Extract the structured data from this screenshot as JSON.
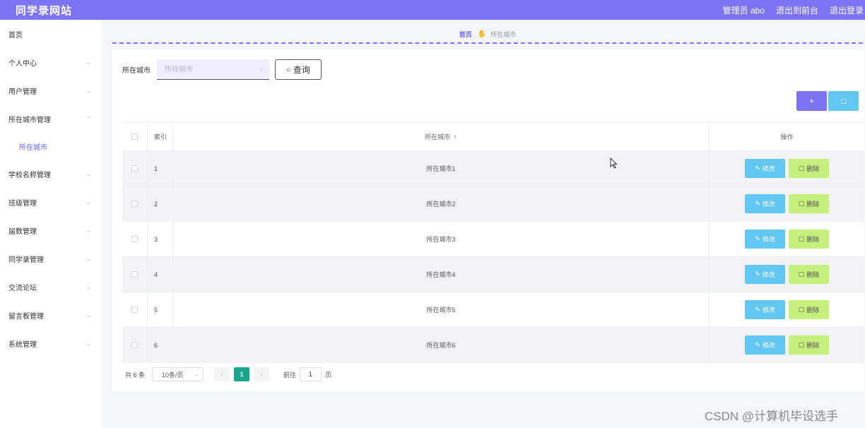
{
  "header": {
    "brand": "同学录网站",
    "admin_label": "管理员 abo",
    "back_front": "退出到前台",
    "logout": "退出登录",
    "accent": "#7c74f4"
  },
  "sidebar": {
    "home": "首页",
    "items": [
      {
        "label": "个人中心",
        "chevron": "chevron-down"
      },
      {
        "label": "用户管理",
        "chevron": "chevron-down"
      },
      {
        "label": "所在城市管理",
        "chevron": "chevron-up"
      },
      {
        "label": "所在城市",
        "chevron": "",
        "sub": true,
        "active": true
      },
      {
        "label": "学校名称管理",
        "chevron": "chevron-down"
      },
      {
        "label": "班级管理",
        "chevron": "chevron-down"
      },
      {
        "label": "届数管理",
        "chevron": "chevron-down"
      },
      {
        "label": "同学录管理",
        "chevron": "chevron-down"
      },
      {
        "label": "交流论坛",
        "chevron": "chevron-down"
      },
      {
        "label": "留言板管理",
        "chevron": "chevron-down"
      },
      {
        "label": "系统管理",
        "chevron": "chevron-down"
      }
    ]
  },
  "breadcrumb": {
    "home": "首页",
    "current": "所在城市"
  },
  "search": {
    "label": "所在城市",
    "placeholder": "所在城市",
    "value": "",
    "query_button": "查询"
  },
  "actions": {
    "add_icon": "plus-icon",
    "delete_icon": "trash-icon"
  },
  "table": {
    "columns": [
      "索引",
      "所在城市",
      "操作"
    ],
    "rows": [
      {
        "index": "1",
        "city": "所在城市1"
      },
      {
        "index": "2",
        "city": "所在城市2"
      },
      {
        "index": "3",
        "city": "所在城市3"
      },
      {
        "index": "4",
        "city": "所在城市4"
      },
      {
        "index": "5",
        "city": "所在城市5"
      },
      {
        "index": "6",
        "city": "所在城市6"
      }
    ],
    "edit_label": "修改",
    "delete_label": "删除"
  },
  "pagination": {
    "total": "共 6 条",
    "page_size": "10条/页",
    "current_page": "1",
    "goto_label": "前往",
    "goto_value": "1",
    "page_unit": "页"
  },
  "watermark": "CSDN @计算机毕设选手"
}
